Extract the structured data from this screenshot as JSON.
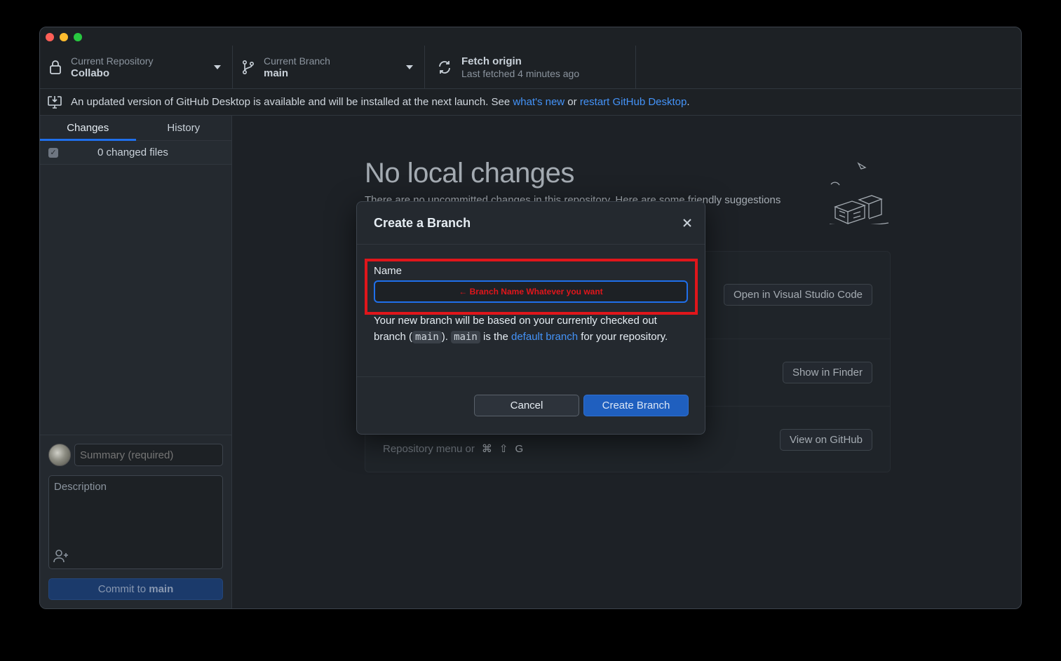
{
  "toolbar": {
    "repo_label": "Current Repository",
    "repo_value": "Collabo",
    "branch_label": "Current Branch",
    "branch_value": "main",
    "fetch_label": "Fetch origin",
    "fetch_value": "Last fetched 4 minutes ago"
  },
  "banner": {
    "text": "An updated version of GitHub Desktop is available and will be installed at the next launch. See ",
    "link1": "what's new",
    "middle": " or ",
    "link2": "restart GitHub Desktop",
    "end": "."
  },
  "sidebar": {
    "tabs": [
      {
        "label": "Changes",
        "active": true
      },
      {
        "label": "History",
        "active": false
      }
    ],
    "changed_files": "0 changed files",
    "summary_placeholder": "Summary (required)",
    "description_placeholder": "Description",
    "commit_prefix": "Commit to ",
    "commit_branch": "main"
  },
  "main": {
    "title": "No local changes",
    "subtitle": "There are no uncommitted changes in this repository. Here are some friendly suggestions",
    "suggestions": [
      {
        "button": "Open in Visual Studio Code"
      },
      {
        "button": "Show in Finder"
      },
      {
        "button": "View on GitHub",
        "hint": "Repository menu or",
        "shortcut": [
          "⌘",
          "⇧",
          "G"
        ]
      }
    ]
  },
  "dialog": {
    "title": "Create a Branch",
    "name_label": "Name",
    "name_value": "",
    "annotation": "← Branch Name Whatever you want",
    "desc_part1": "Your new branch will be based on your currently checked out branch (",
    "desc_code1": "main",
    "desc_part2": "). ",
    "desc_code2": "main",
    "desc_part3": " is the ",
    "desc_link": "default branch",
    "desc_part4": " for your repository.",
    "cancel": "Cancel",
    "create": "Create Branch"
  },
  "colors": {
    "accent": "#1f6feb",
    "link": "#4493f8",
    "annotation": "#e0161b"
  }
}
